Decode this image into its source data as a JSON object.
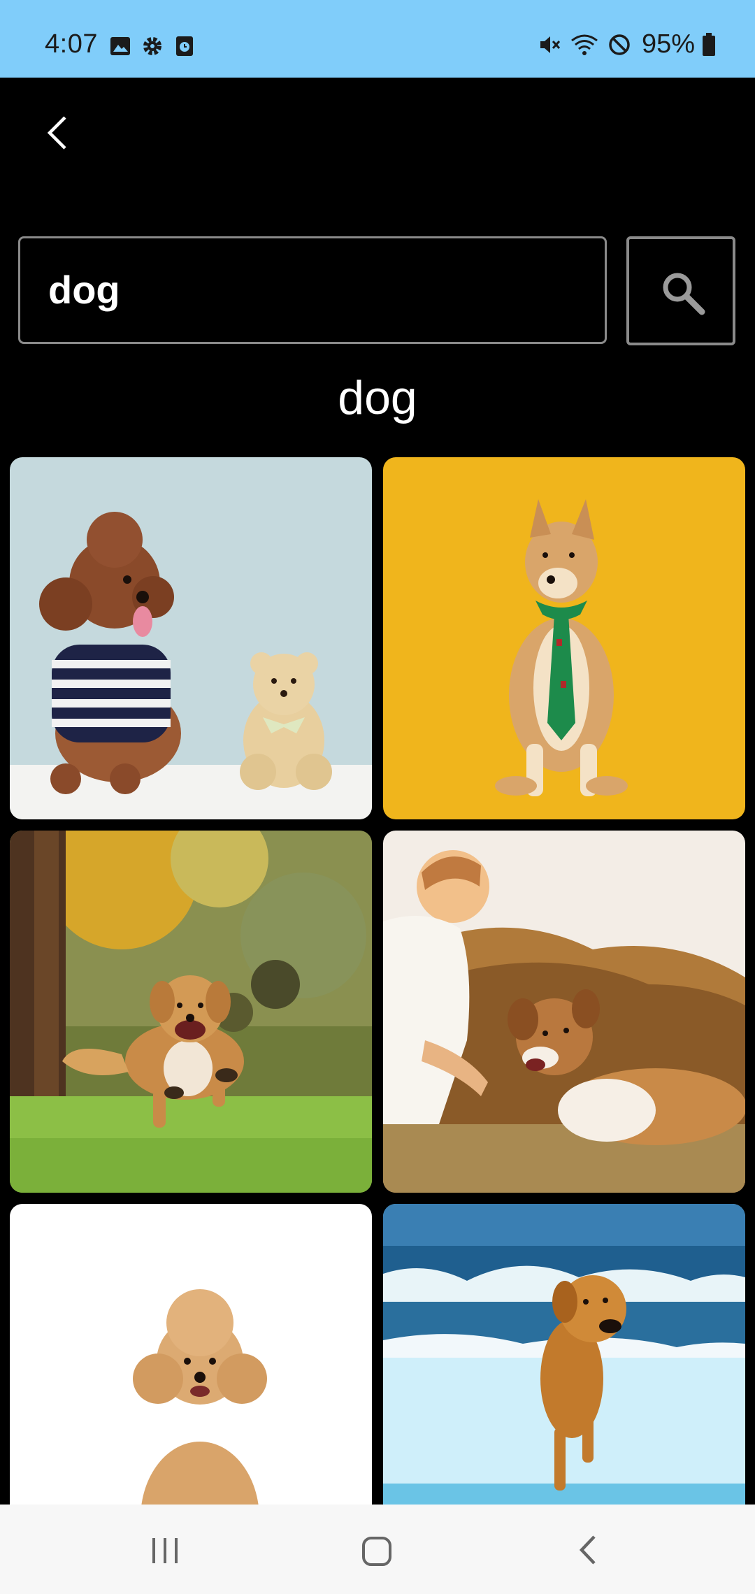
{
  "status_bar": {
    "time": "4:07",
    "battery_percent": "95%",
    "left_icons": [
      "image-icon",
      "gear-icon",
      "clock-app-icon"
    ],
    "right_icons": [
      "mute-icon",
      "wifi-icon",
      "do-not-disturb-icon",
      "battery-icon"
    ],
    "background_color": "#80cdfa"
  },
  "app_bar": {
    "back_icon": "chevron-left-icon"
  },
  "search": {
    "value": "dog",
    "button_icon": "search-icon"
  },
  "results": {
    "query_title": "dog",
    "images": [
      {
        "subject": "poodle in striped shirt with teddy bear"
      },
      {
        "subject": "shiba inu with green tie on yellow background"
      },
      {
        "subject": "golden retriever running on grass"
      },
      {
        "subject": "man sitting with dog at sunset"
      },
      {
        "subject": "poodle sitting on white background"
      },
      {
        "subject": "dog running on beach"
      }
    ]
  },
  "nav_bar": {
    "icons": [
      "recents-icon",
      "home-icon",
      "back-icon"
    ]
  }
}
